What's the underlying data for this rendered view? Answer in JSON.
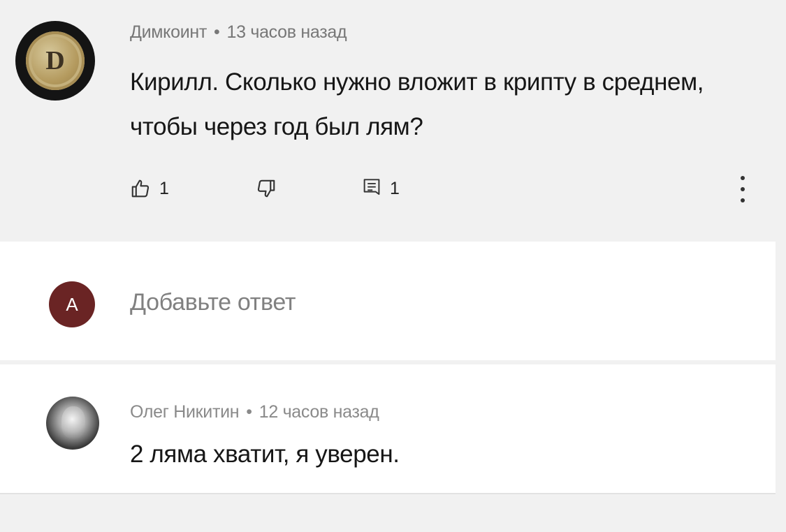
{
  "comment": {
    "author": "Димкоинт",
    "separator": "•",
    "time": "13 часов назад",
    "avatar_letter": "D",
    "text": "Кирилл. Сколько нужно вложит в крипту в среднем, чтобы через год был лям?",
    "like_count": "1",
    "reply_count": "1",
    "icons": {
      "like": "thumbs-up-icon",
      "dislike": "thumbs-down-icon",
      "reply": "comment-icon",
      "more": "more-vertical-icon"
    }
  },
  "reply_input": {
    "avatar_letter": "A",
    "placeholder": "Добавьте ответ"
  },
  "reply": {
    "author": "Олег Никитин",
    "separator": "•",
    "time": "12 часов назад",
    "text": "2 ляма хватит, я уверен."
  }
}
